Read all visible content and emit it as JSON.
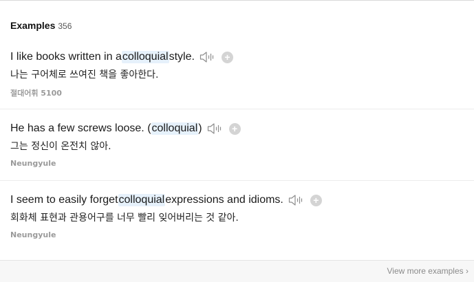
{
  "section": {
    "title": "Examples",
    "count": "356"
  },
  "examples": [
    {
      "en_before": "I like books written in a ",
      "en_highlight": "colloquial",
      "en_after": " style.",
      "ko": "나는 구어체로 쓰여진 책을 좋아한다.",
      "source": "절대어휘 5100"
    },
    {
      "en_before": "He has a few screws loose. (",
      "en_highlight": "colloquial",
      "en_after": ")",
      "ko": "그는 정신이 온전치 않아.",
      "source": "Neungyule"
    },
    {
      "en_before": "I seem to easily forget ",
      "en_highlight": "colloquial",
      "en_after": " expressions and idioms.",
      "ko": "회화체 표현과 관용어구를 너무 빨리 잊어버리는 것 같아.",
      "source": "Neungyule"
    }
  ],
  "footer": {
    "view_more": "View more examples"
  },
  "icons": {
    "speaker": "speaker-icon",
    "add": "plus-icon",
    "chevron": "chevron-right-icon"
  },
  "colors": {
    "highlight": "#e6f1fb",
    "plus_bg": "#d4d4d4",
    "source_text": "#9a9a9a"
  }
}
